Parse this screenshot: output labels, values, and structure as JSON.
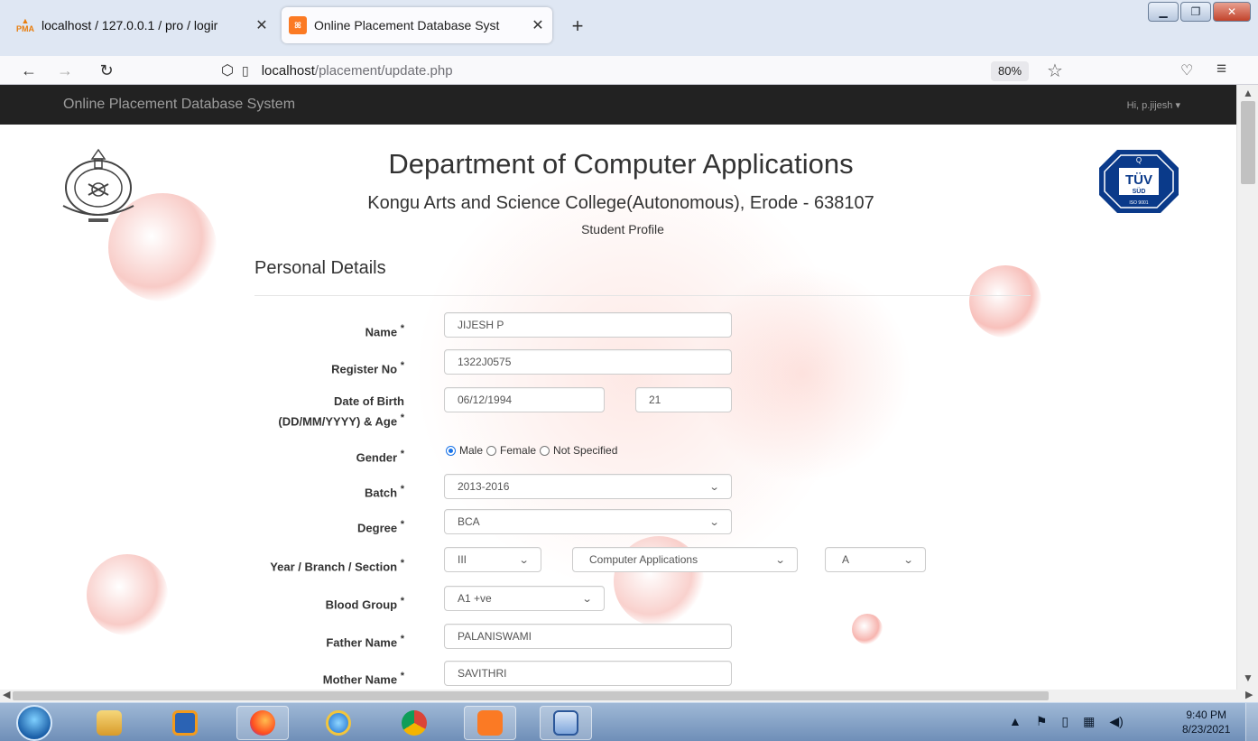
{
  "browser": {
    "tabs": [
      {
        "title": "localhost / 127.0.0.1 / pro / logir",
        "icon": "phpmyadmin-icon"
      },
      {
        "title": "Online Placement Database Syst",
        "icon": "xampp-icon",
        "active": true
      }
    ],
    "url_host": "localhost",
    "url_path": "/placement/update.php",
    "zoom": "80%"
  },
  "page": {
    "brand": "Online Placement Database System",
    "user_menu": "Hi, p.jijesh",
    "title": "Department of Computer Applications",
    "subtitle": "Kongu Arts and Science College(Autonomous), Erode - 638107",
    "profile_label": "Student Profile",
    "section_title": "Personal Details"
  },
  "form": {
    "name": {
      "label": "Name",
      "value": "JIJESH P"
    },
    "register_no": {
      "label": "Register No",
      "value": "1322J0575"
    },
    "dob": {
      "label_line1": "Date of Birth",
      "label_line2": "(DD/MM/YYYY) & Age",
      "value": "06/12/1994",
      "age": "21"
    },
    "gender": {
      "label": "Gender",
      "options": [
        "Male",
        "Female",
        "Not Specified"
      ],
      "selected": "Male"
    },
    "batch": {
      "label": "Batch",
      "value": "2013-2016"
    },
    "degree": {
      "label": "Degree",
      "value": "BCA"
    },
    "year_branch_section": {
      "label": "Year / Branch / Section",
      "year": "III",
      "branch": "Computer Applications",
      "section": "A"
    },
    "blood_group": {
      "label": "Blood Group",
      "value": "A1 +ve"
    },
    "father_name": {
      "label": "Father Name",
      "value": "PALANISWAMI"
    },
    "mother_name": {
      "label": "Mother Name",
      "value": "SAVITHRI"
    },
    "required_mark": "*"
  },
  "taskbar": {
    "time": "9:40 PM",
    "date": "8/23/2021"
  },
  "colors": {
    "topbar": "#222222",
    "radio_accent": "#1a73e8"
  }
}
